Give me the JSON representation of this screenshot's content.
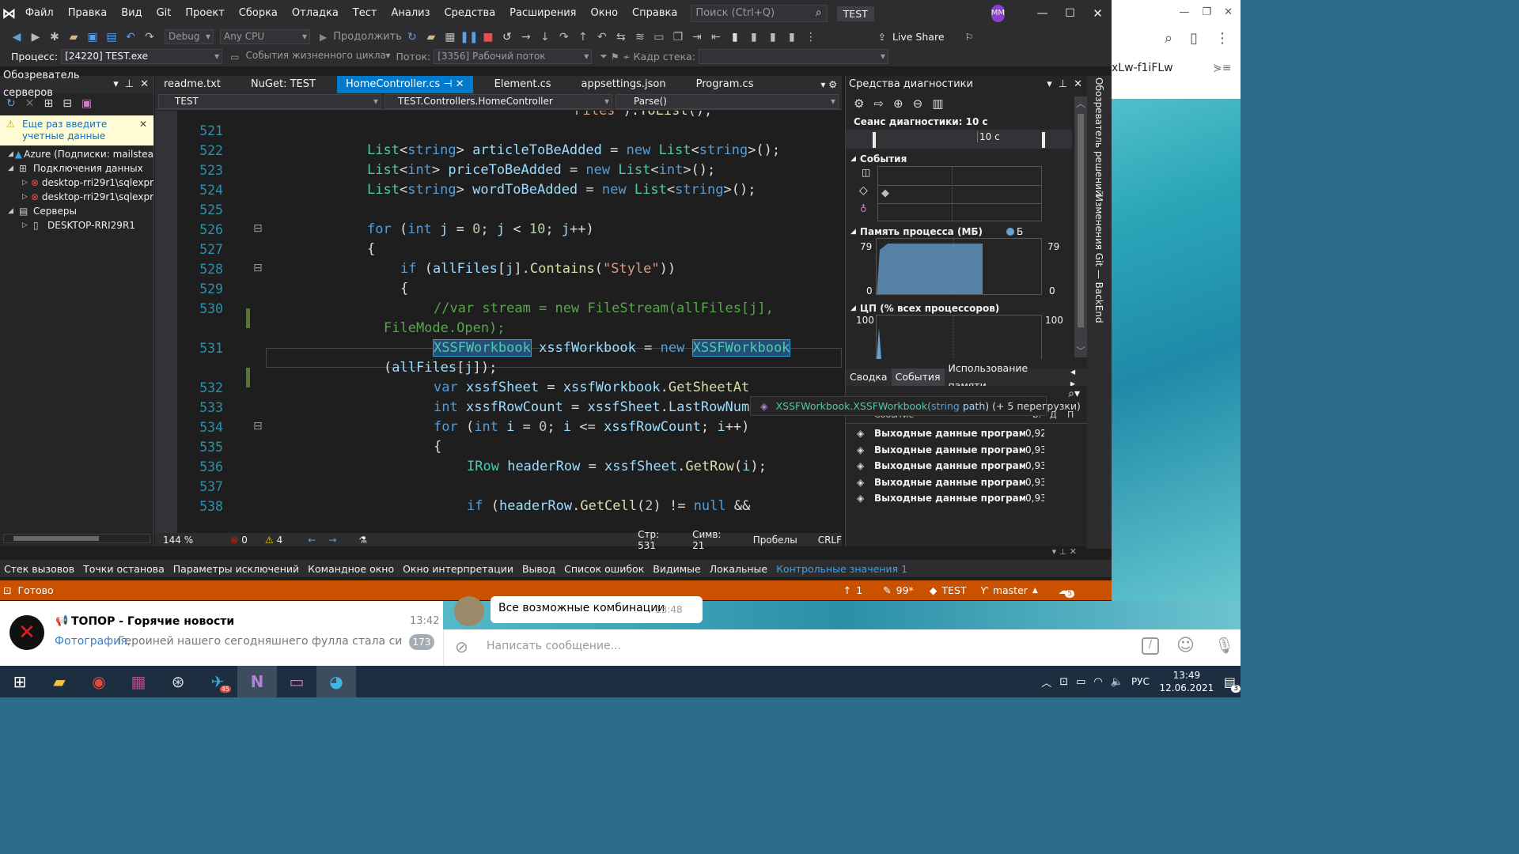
{
  "title_bar": {
    "menu": [
      "Файл",
      "Правка",
      "Вид",
      "Git",
      "Проект",
      "Сборка",
      "Отладка",
      "Тест",
      "Анализ",
      "Средства",
      "Расширения",
      "Окно",
      "Справка"
    ],
    "search_placeholder": "Поиск (Ctrl+Q)",
    "solution_name": "TEST",
    "user_initials": "MM"
  },
  "toolbar": {
    "config": "Debug",
    "platform": "Any CPU",
    "continue_label": "Продолжить",
    "live_share": "Live Share",
    "process_label": "Процесс:",
    "process_value": "[24220] TEST.exe",
    "lifecycle_label": "События жизненного цикла",
    "thread_label": "Поток:",
    "thread_value": "[3356] Рабочий поток",
    "stack_frame_label": "Кадр стека:"
  },
  "server_explorer": {
    "title": "Обозреватель серверов",
    "warning": "Еще раз введите учетные данные",
    "items": [
      {
        "label": "Azure (Подписки: mailstea",
        "level": 0
      },
      {
        "label": "Подключения данных",
        "level": 0
      },
      {
        "label": "desktop-rri29r1\\sqlexpr",
        "level": 1
      },
      {
        "label": "desktop-rri29r1\\sqlexpr",
        "level": 1
      },
      {
        "label": "Серверы",
        "level": 0
      },
      {
        "label": "DESKTOP-RRI29R1",
        "level": 1
      }
    ]
  },
  "editor": {
    "tabs": [
      "readme.txt",
      "NuGet: TEST",
      "HomeController.cs",
      "Element.cs",
      "appsettings.json",
      "Program.cs"
    ],
    "active_tab": "HomeController.cs",
    "nav_project": "TEST",
    "nav_class": "TEST.Controllers.HomeController",
    "nav_member": "Parse()",
    "zoom": "144 %",
    "errors": "0",
    "warnings": "4",
    "line_info": "Стр: 531",
    "col_info": "Симв: 21",
    "whitespace": "Пробелы",
    "eol": "CRLF",
    "tooltip": {
      "prefix": "XSSFWorkbook.XSSFWorkbook(",
      "param_type": "string",
      "param_name": "path",
      "suffix": ") (+ 5 перегрузки)"
    }
  },
  "code_lines": [
    {
      "n": "",
      "t": "\"Files\").ToList();"
    },
    {
      "n": "521",
      "t": ""
    },
    {
      "n": "522",
      "t": "List<string> articleToBeAdded = new List<string>();"
    },
    {
      "n": "523",
      "t": "List<int> priceToBeAdded = new List<int>();"
    },
    {
      "n": "524",
      "t": "List<string> wordToBeAdded = new List<string>();"
    },
    {
      "n": "525",
      "t": ""
    },
    {
      "n": "526",
      "t": "for (int j = 0; j < 10; j++)"
    },
    {
      "n": "527",
      "t": "{"
    },
    {
      "n": "528",
      "t": "if (allFiles[j].Contains(\"Style\"))"
    },
    {
      "n": "529",
      "t": "{"
    },
    {
      "n": "530",
      "t": "//var stream = new FileStream(allFiles[j],"
    },
    {
      "n": "",
      "t": "FileMode.Open);"
    },
    {
      "n": "531",
      "t": "XSSFWorkbook xssfWorkbook = new XSSFWorkbook"
    },
    {
      "n": "",
      "t": "(allFiles[j]);"
    },
    {
      "n": "532",
      "t": "var xssfSheet = xssfWorkbook.GetSheetAt"
    },
    {
      "n": "533",
      "t": "int xssfRowCount = xssfSheet.LastRowNum;"
    },
    {
      "n": "534",
      "t": "for (int i = 0; i <= xssfRowCount; i++)"
    },
    {
      "n": "535",
      "t": "{"
    },
    {
      "n": "536",
      "t": "IRow headerRow = xssfSheet.GetRow(i);"
    },
    {
      "n": "537",
      "t": ""
    },
    {
      "n": "538",
      "t": "if (headerRow.GetCell(2) != null &&"
    }
  ],
  "diagnostics": {
    "title": "Средства диагностики",
    "session": "Сеанс диагностики: 10 с",
    "timeline_label": "10 с",
    "events_label": "События",
    "memory_label": "Память процесса (МБ)",
    "memory_legend": "Б",
    "memory_max": "79",
    "memory_min": "0",
    "cpu_label": "ЦП (% всех процессоров)",
    "cpu_max": "100",
    "tabs": [
      "Сводка",
      "События",
      "Использование памяти"
    ],
    "active_tab": "События",
    "col_event": "Событие",
    "col_time_short": "В.",
    "col_duration_short": "Д",
    "col_p": "П",
    "events": [
      {
        "label": "Выходные данные програм...",
        "time": "0,92"
      },
      {
        "label": "Выходные данные програм...",
        "time": "0,93"
      },
      {
        "label": "Выходные данные програм...",
        "time": "0,93"
      },
      {
        "label": "Выходные данные програм...",
        "time": "0,93"
      },
      {
        "label": "Выходные данные програм...",
        "time": "0,93"
      }
    ]
  },
  "side_tabs": [
    "Обозреватель решений",
    "Изменения Git — BackEnd"
  ],
  "bottom_tabs": [
    "Стек вызовов",
    "Точки останова",
    "Параметры исключений",
    "Командное окно",
    "Окно интерпретации",
    "Вывод",
    "Список ошибок",
    "Видимые",
    "Локальные",
    "Контрольные значения 1"
  ],
  "bottom_active": "Контрольные значения 1",
  "status": {
    "ready": "Готово",
    "up_count": "1",
    "edits": "99*",
    "repo": "TEST",
    "branch": "master",
    "notifications": "5"
  },
  "browser_snippet": "xLw-f1iFLw",
  "telegram": {
    "chat_name": "ТОПОР - Горячие новости",
    "chat_time": "13:42",
    "preview_label": "Фотография,",
    "preview_text": " Героиней нашего сегодняшнего фулла стала симпати...",
    "unread": "173",
    "message_text": "Все возможные комбинации",
    "message_time": "13:48",
    "input_placeholder": "Написать сообщение..."
  },
  "taskbar": {
    "lang": "РУС",
    "time": "13:49",
    "date": "12.06.2021",
    "notif_count": "3",
    "telegram_badge": "45"
  },
  "colors": {
    "vs_accent": "#007acc",
    "status_bar": "#ca5100",
    "title_bg": "#2d2d30"
  }
}
